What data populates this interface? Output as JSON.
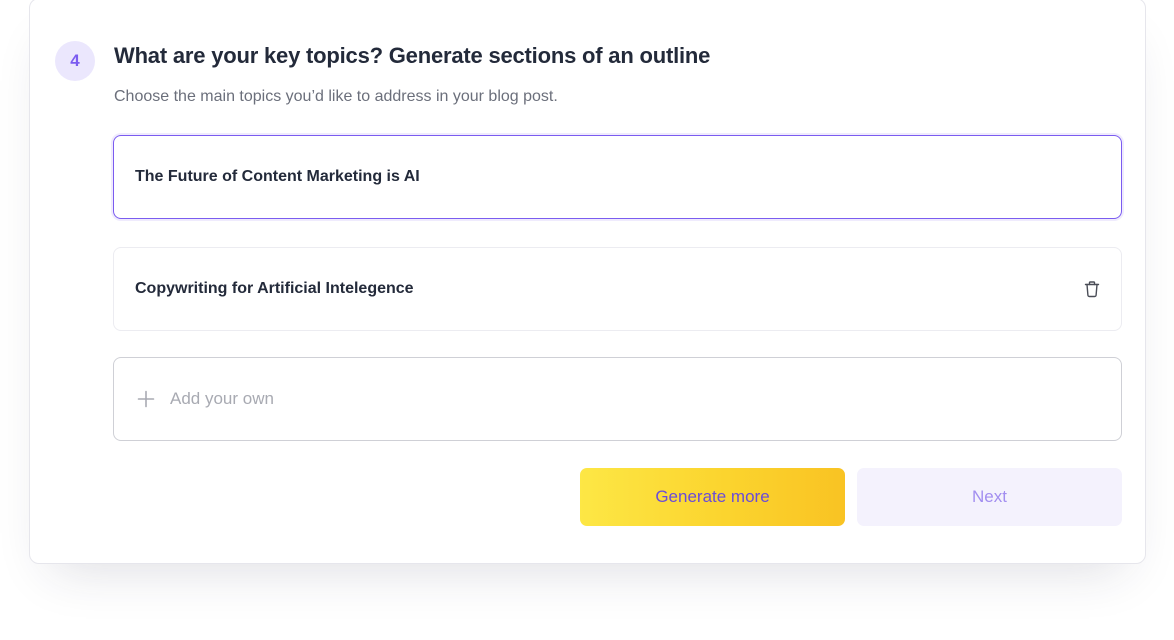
{
  "step": {
    "number": "4",
    "title": "What are your key topics? Generate sections of an outline",
    "subtitle": "Choose the main topics you’d like to address in your blog post."
  },
  "topics": [
    {
      "label": "The Future of Content Marketing is AI",
      "selected": true
    },
    {
      "label": "Copywriting for Artificial Intelegence",
      "selected": false,
      "action_icon": "trash-icon"
    }
  ],
  "add_own": {
    "placeholder": "Add your own",
    "value": "",
    "icon": "plus-icon"
  },
  "buttons": {
    "generate_label": "Generate more",
    "next_label": "Next"
  },
  "colors": {
    "accent": "#7b5cf0",
    "badge_bg": "#ebe7fd",
    "generate_gradient_start": "#fde745",
    "generate_gradient_end": "#f9c323",
    "next_bg": "#f4f2fd",
    "next_text": "#a28ef0"
  }
}
